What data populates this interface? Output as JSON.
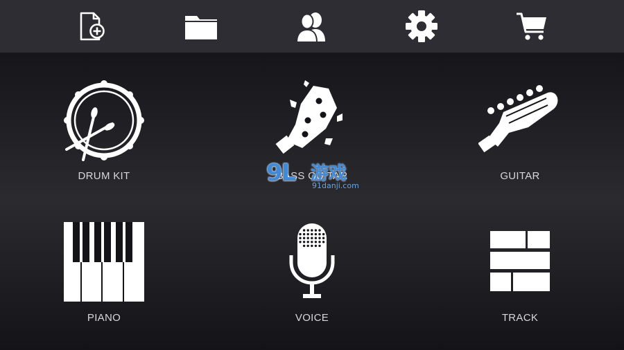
{
  "toolbar": {
    "buttons": [
      {
        "icon": "new-file-icon"
      },
      {
        "icon": "folder-icon"
      },
      {
        "icon": "users-icon"
      },
      {
        "icon": "gear-icon"
      },
      {
        "icon": "cart-icon"
      }
    ]
  },
  "instruments": [
    {
      "label": "DRUM KIT",
      "icon": "drum-kit-icon"
    },
    {
      "label": "BASS GUITAR",
      "icon": "bass-guitar-headstock-icon"
    },
    {
      "label": "GUITAR",
      "icon": "guitar-headstock-icon"
    },
    {
      "label": "PIANO",
      "icon": "piano-keys-icon"
    },
    {
      "label": "VOICE",
      "icon": "microphone-icon"
    },
    {
      "label": "TRACK",
      "icon": "track-bricks-icon"
    }
  ],
  "watermark": {
    "logo_text": "9L",
    "cn_text": "游戏",
    "url": "91danji.com"
  },
  "colors": {
    "toolbar_bg": "#2d2d33",
    "icon": "#ffffff",
    "label": "#d8d8dc",
    "watermark": "#3f8bd9"
  }
}
